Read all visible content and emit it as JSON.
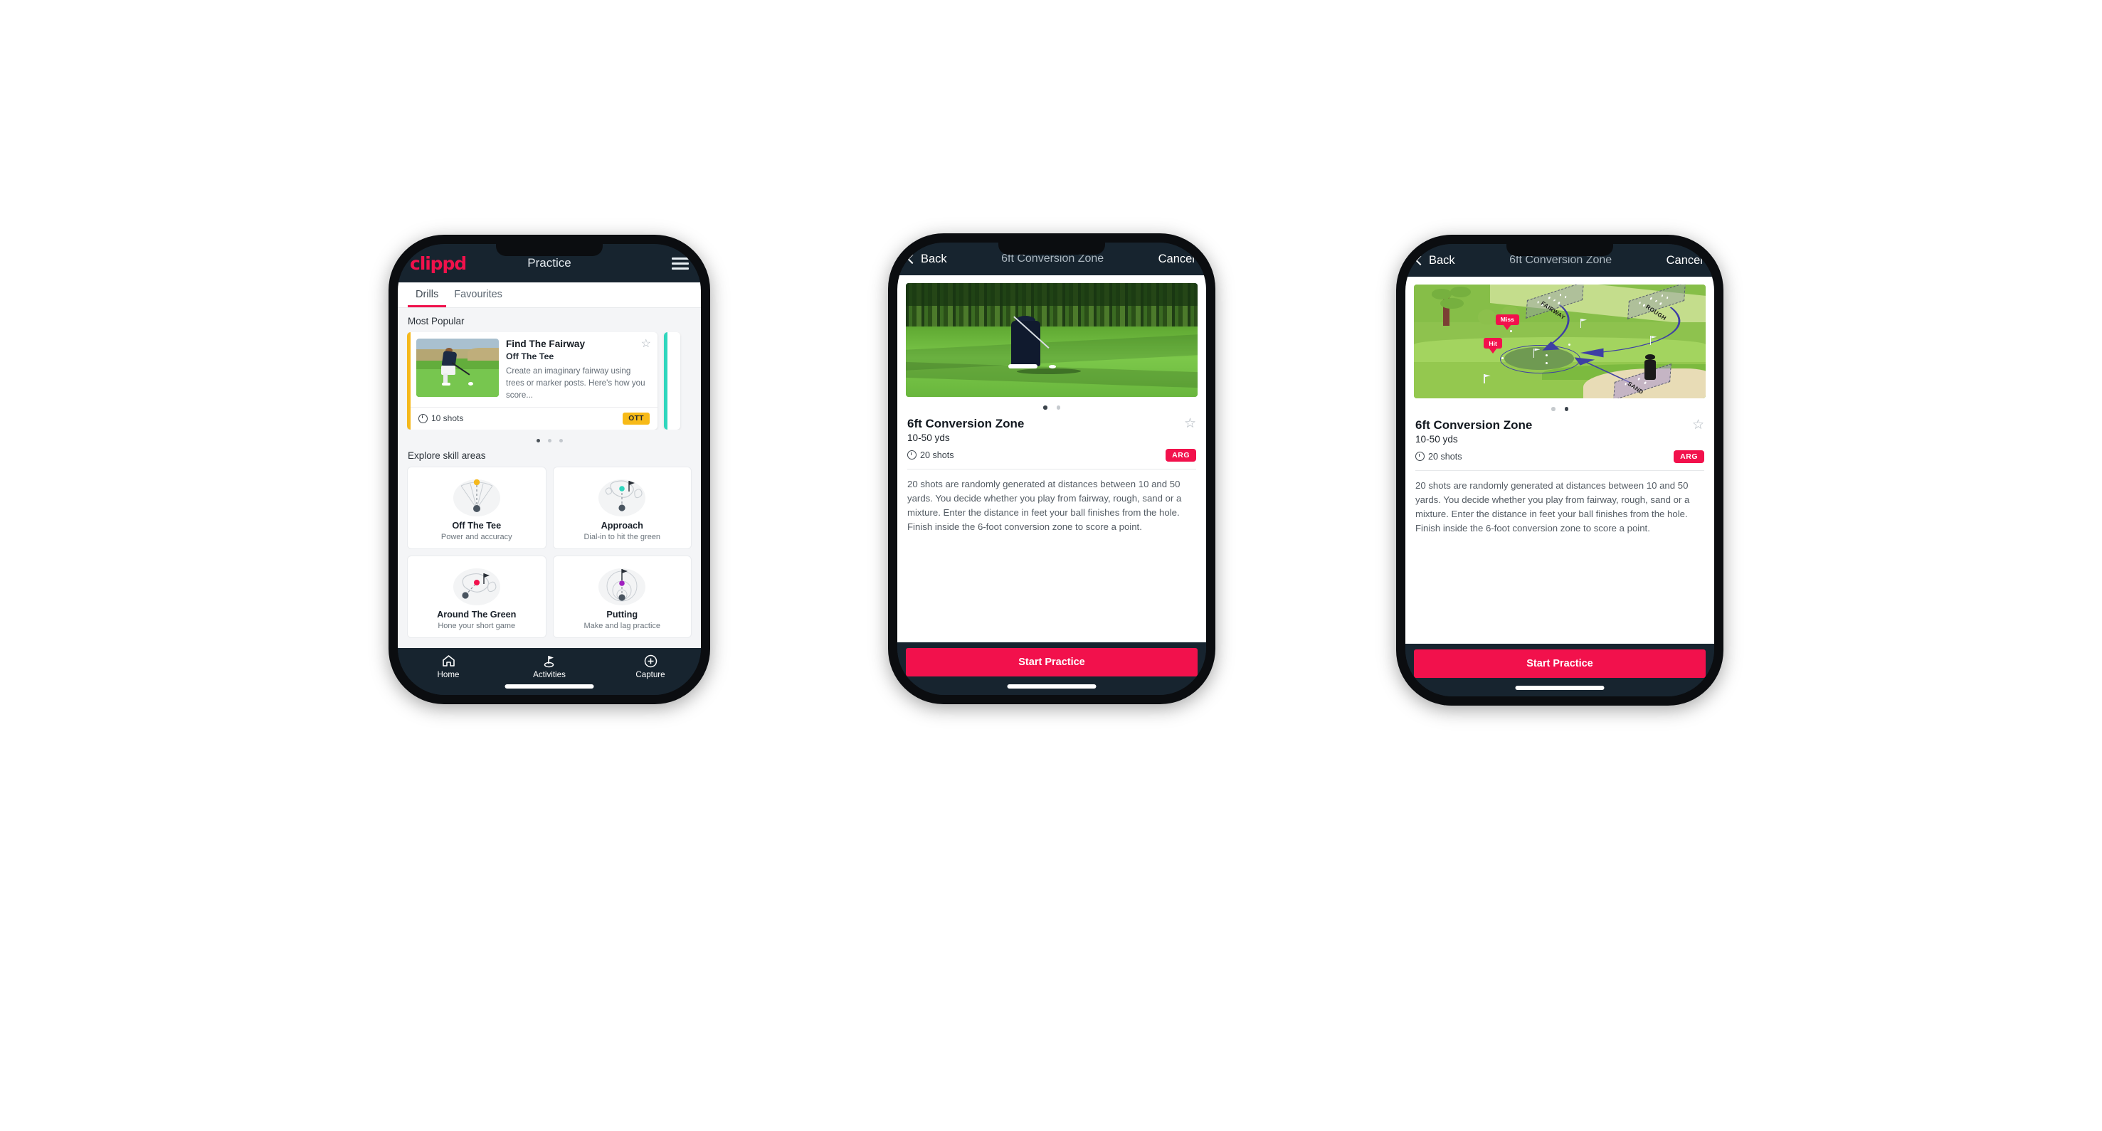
{
  "colors": {
    "brand_pink": "#f0114b",
    "dark_navy": "#17242f",
    "amber": "#f7ba18",
    "teal": "#2fd6bd",
    "page_bg": "#f4f5f7"
  },
  "phone1": {
    "logo": "clippd",
    "title": "Practice",
    "menu_icon": "hamburger-menu-icon",
    "tabs": [
      {
        "label": "Drills",
        "active": true
      },
      {
        "label": "Favourites",
        "active": false
      }
    ],
    "most_popular_label": "Most Popular",
    "drill_card": {
      "title": "Find The Fairway",
      "subtitle": "Off The Tee",
      "description": "Create an imaginary fairway using trees or marker posts. Here's how you score...",
      "shots": "10 shots",
      "badge": "OTT",
      "badge_color": "#f7ba18",
      "accent_color": "#f5b81c",
      "favourite_icon": "star-outline-icon"
    },
    "carousel_dots": {
      "count": 3,
      "active_index": 0
    },
    "explore_label": "Explore skill areas",
    "skill_areas": [
      {
        "name": "Off The Tee",
        "desc": "Power and accuracy",
        "icon": "tee-shot-fan-icon",
        "dot_color": "#f5b81c"
      },
      {
        "name": "Approach",
        "desc": "Dial-in to hit the green",
        "icon": "approach-green-icon",
        "dot_color": "#2fd6bd"
      },
      {
        "name": "Around The Green",
        "desc": "Hone your short game",
        "icon": "around-green-icon",
        "dot_color": "#f2114c"
      },
      {
        "name": "Putting",
        "desc": "Make and lag practice",
        "icon": "putting-rings-icon",
        "dot_color": "#a020c0"
      }
    ],
    "bottom_nav": [
      {
        "label": "Home",
        "icon": "home-icon",
        "active": false
      },
      {
        "label": "Activities",
        "icon": "golf-flag-icon",
        "active": true
      },
      {
        "label": "Capture",
        "icon": "plus-circle-icon",
        "active": false
      }
    ]
  },
  "phone2": {
    "back_label": "Back",
    "back_icon": "chevron-left-icon",
    "title": "6ft Conversion Zone",
    "cancel_label": "Cancel",
    "media_type": "golfer-chipping-photo",
    "carousel_dots": {
      "count": 2,
      "active_index": 0
    },
    "detail": {
      "title": "6ft Conversion Zone",
      "distance": "10-50 yds",
      "shots": "20 shots",
      "badge": "ARG",
      "badge_color": "#f2114c",
      "favourite_icon": "star-outline-icon",
      "description": "20 shots are randomly generated at distances between 10 and 50 yards. You decide whether you play from fairway, rough, sand or a mixture. Enter the distance in feet your ball finishes from the hole. Finish inside the 6-foot conversion zone to score a point."
    },
    "cta_label": "Start Practice"
  },
  "phone3": {
    "back_label": "Back",
    "back_icon": "chevron-left-icon",
    "title": "6ft Conversion Zone",
    "cancel_label": "Cancel",
    "media_type": "course-diagram-illustration",
    "course_labels": {
      "fairway": "FAIRWAY",
      "rough": "ROUGH",
      "sand": "SAND",
      "miss": "Miss",
      "hit": "Hit"
    },
    "carousel_dots": {
      "count": 2,
      "active_index": 1
    },
    "detail": {
      "title": "6ft Conversion Zone",
      "distance": "10-50 yds",
      "shots": "20 shots",
      "badge": "ARG",
      "badge_color": "#f2114c",
      "favourite_icon": "star-outline-icon",
      "description": "20 shots are randomly generated at distances between 10 and 50 yards. You decide whether you play from fairway, rough, sand or a mixture. Enter the distance in feet your ball finishes from the hole. Finish inside the 6-foot conversion zone to score a point."
    },
    "cta_label": "Start Practice"
  }
}
